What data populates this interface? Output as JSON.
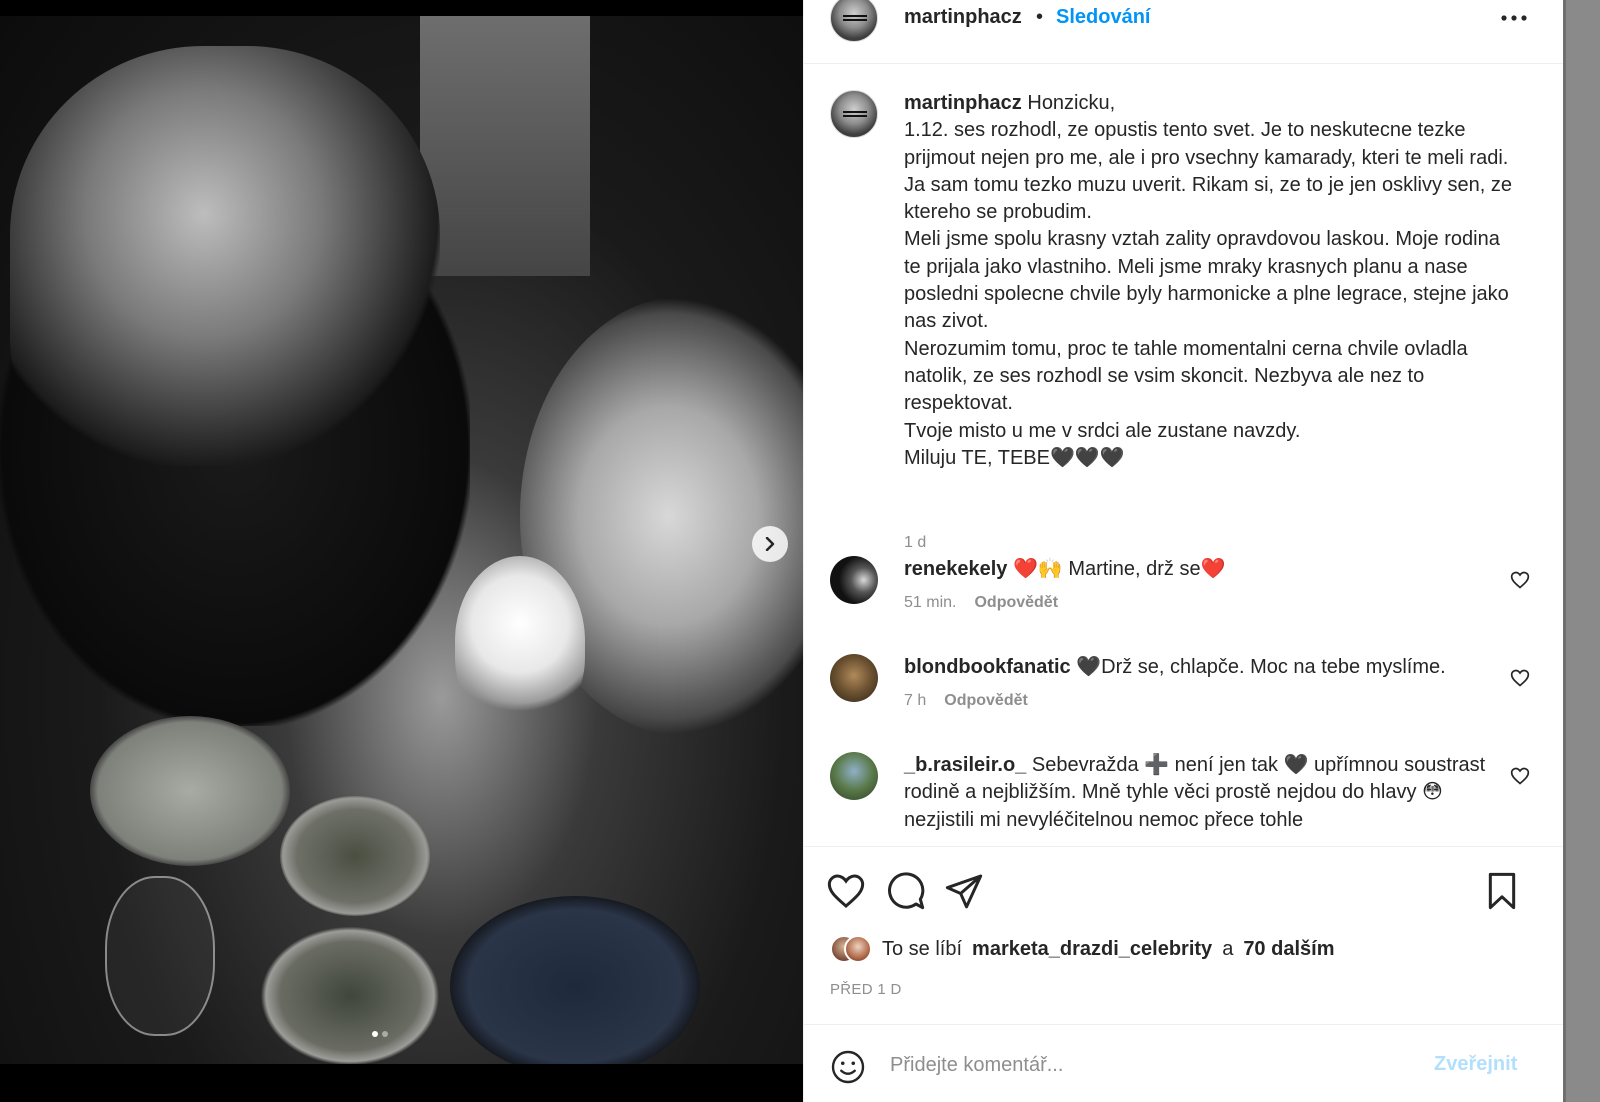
{
  "post": {
    "username": "martinphacz",
    "bullet": "•",
    "follow_label": "Sledování",
    "caption_username": "martinphacz",
    "caption_body": " Honzicku,\n1.12. ses rozhodl, ze opustis tento svet. Je to neskutecne tezke prijmout nejen pro me, ale i pro vsechny kamarady, kteri te meli radi.\nJa sam tomu tezko muzu uverit. Rikam si, ze to je jen osklivy sen, ze ktereho se probudim.\nMeli jsme spolu krasny vztah zality opravdovou laskou. Moje rodina te prijala jako vlastniho. Meli jsme mraky krasnych planu a nase posledni spolecne chvile byly harmonicke a plne legrace, stejne jako nas zivot.\nNerozumim tomu, proc te tahle momentalni cerna chvile ovladla natolik, ze ses rozhodl se vsim skoncit. Nezbyva ale nez to respektovat.\nTvoje misto u me v srdci ale zustane navzdy.\nMiluju TE, TEBE🖤🖤🖤",
    "caption_time": "1 d"
  },
  "comments": [
    {
      "username": "renekekely",
      "text": " ❤️🙌 Martine, drž se❤️",
      "time": "51 min.",
      "reply_label": "Odpovědět"
    },
    {
      "username": "blondbookfanatic",
      "text": " 🖤Drž se, chlapče. Moc na tebe myslíme.",
      "time": "7 h",
      "reply_label": "Odpovědět"
    },
    {
      "username": "_b.rasileir.o_",
      "text": " Sebevražda ➕ není jen tak 🖤 upřímnou soustrast rodině a nejbližším. Mně tyhle věci prostě nejdou do hlavy 😳 nezjistili mi nevyléčitelnou nemoc přece tohle",
      "time": "",
      "reply_label": ""
    }
  ],
  "likes": {
    "prefix": "To se líbí",
    "user": "marketa_drazdi_celebrity",
    "conj": "a",
    "others": "70 dalším"
  },
  "posted_ago": "PŘED 1 D",
  "composer": {
    "placeholder": "Přidejte komentář...",
    "post_label": "Zveřejnit"
  },
  "icons": {
    "more": "more-horizontal-icon",
    "like": "heart-icon",
    "comment": "comment-icon",
    "share": "paper-plane-icon",
    "save": "bookmark-icon",
    "emoji": "emoji-smile-icon",
    "next": "chevron-right-icon"
  },
  "colors": {
    "link": "#0095f6",
    "text": "#262626",
    "muted": "#8e8e8e",
    "post_disabled": "#b2dffc"
  },
  "carousel": {
    "current": 1,
    "total": 2
  }
}
